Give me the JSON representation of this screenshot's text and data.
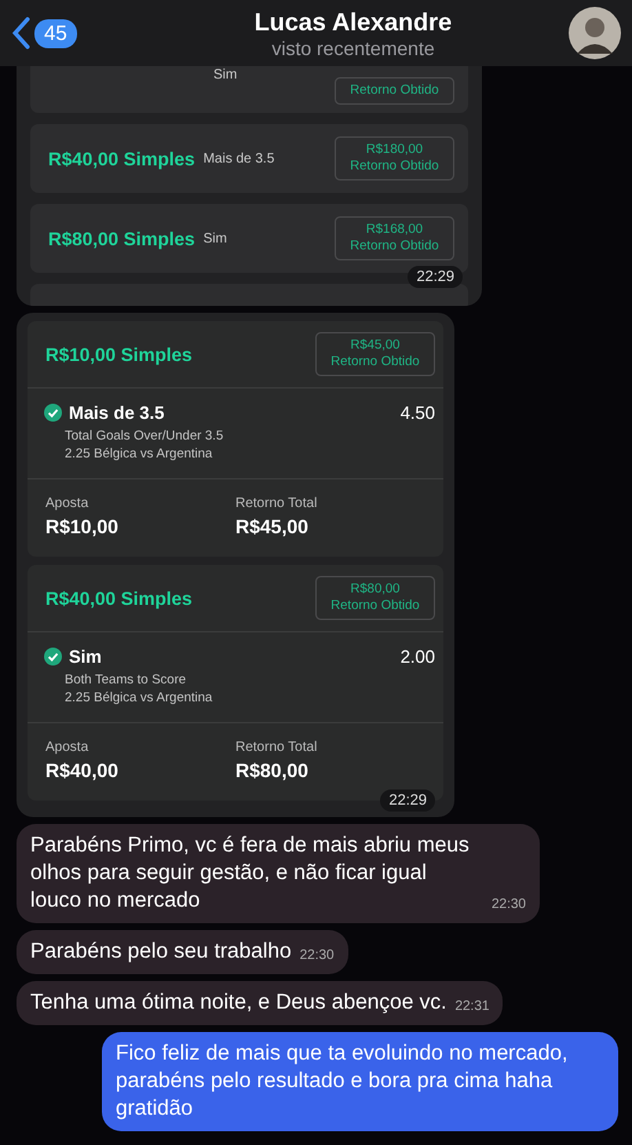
{
  "header": {
    "back_count": "45",
    "title": "Lucas Alexandre",
    "subtitle": "visto recentemente"
  },
  "summary_bubble": {
    "rows": [
      {
        "kind": "clipped",
        "pick": "Sim",
        "return_label": "Retorno Obtido"
      },
      {
        "kind": "full",
        "title": "R$40,00 Simples",
        "pick": "Mais de 3.5",
        "return_amount": "R$180,00",
        "return_label": "Retorno Obtido"
      },
      {
        "kind": "full",
        "title": "R$80,00 Simples",
        "pick": "Sim",
        "return_amount": "R$168,00",
        "return_label": "Retorno Obtido"
      },
      {
        "kind": "edge"
      }
    ],
    "time": "22:29"
  },
  "slips_bubble": {
    "slips": [
      {
        "title": "R$10,00 Simples",
        "return_amount": "R$45,00",
        "return_label": "Retorno Obtido",
        "won": true,
        "pick": "Mais de 3.5",
        "odds": "4.50",
        "market": "Total Goals Over/Under 3.5",
        "event": "2.25 Bélgica vs Argentina",
        "stake_label": "Aposta",
        "stake": "R$10,00",
        "total_label": "Retorno Total",
        "total": "R$45,00"
      },
      {
        "title": "R$40,00 Simples",
        "return_amount": "R$80,00",
        "return_label": "Retorno Obtido",
        "won": true,
        "pick": "Sim",
        "odds": "2.00",
        "market": "Both Teams to Score",
        "event": "2.25 Bélgica vs Argentina",
        "stake_label": "Aposta",
        "stake": "R$40,00",
        "total_label": "Retorno Total",
        "total": "R$80,00"
      }
    ],
    "time": "22:29"
  },
  "messages": [
    {
      "outgoing": false,
      "text": "Parabéns Primo, vc é fera de mais abriu meus olhos para seguir gestão, e não ficar igual louco no mercado",
      "time": "22:30"
    },
    {
      "outgoing": false,
      "text": "Parabéns pelo seu trabalho",
      "time": "22:30"
    },
    {
      "outgoing": false,
      "text": "Tenha uma ótima noite, e Deus abençoe vc.",
      "time": "22:31"
    },
    {
      "outgoing": true,
      "text": "Fico feliz de mais que ta evoluindo no mercado, parabéns pelo resultado e bora pra cima haha gratidão"
    }
  ]
}
